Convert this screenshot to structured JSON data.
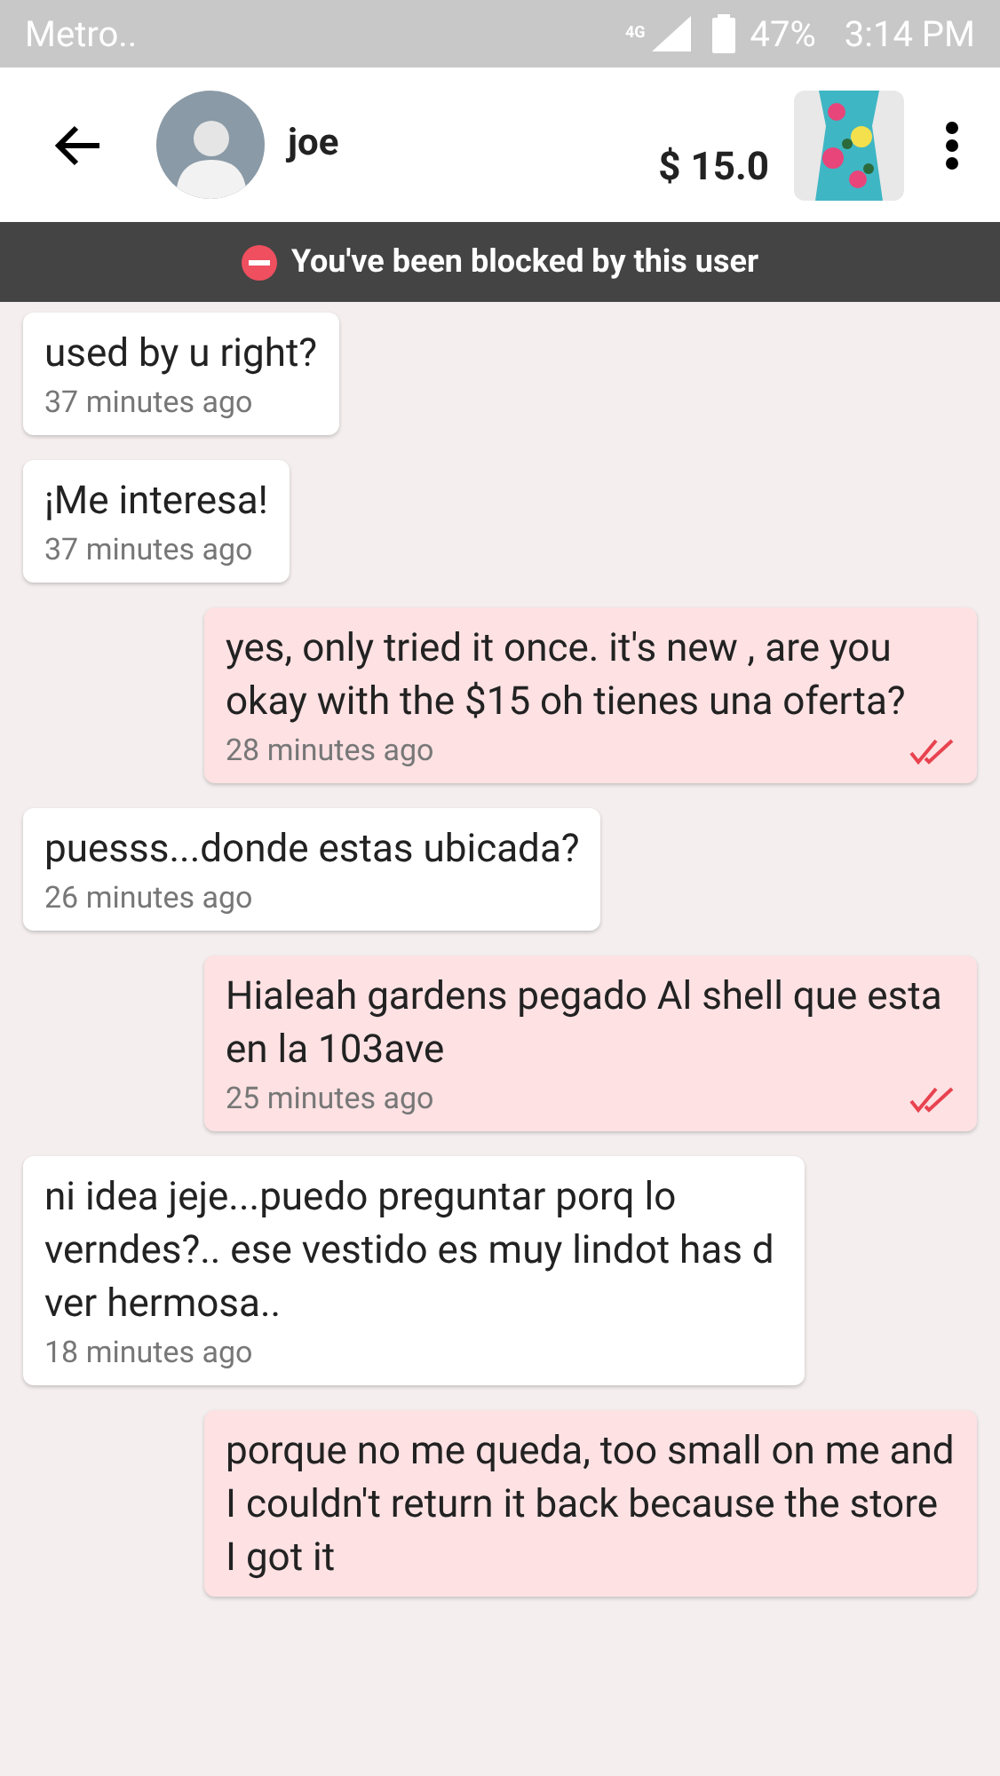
{
  "status_bar": {
    "carrier": "Metro..",
    "network": "4G",
    "battery": "47%",
    "time": "3:14 PM"
  },
  "header": {
    "user_name": "joe",
    "price": "$ 15.0"
  },
  "banner": {
    "text": "You've been blocked by this user"
  },
  "messages": [
    {
      "kind": "incoming",
      "text": "used by u right?",
      "time": "37 minutes ago"
    },
    {
      "kind": "incoming",
      "text": "¡Me interesa!",
      "time": "37 minutes ago"
    },
    {
      "kind": "outgoing",
      "text": "yes, only tried it once. it's new , are you okay with the $15 oh tienes una oferta?",
      "time": "28 minutes ago",
      "read": true
    },
    {
      "kind": "incoming",
      "text": "puesss...donde estas ubicada?",
      "time": "26 minutes ago"
    },
    {
      "kind": "outgoing",
      "text": "Hialeah gardens pegado Al shell que esta en la 103ave",
      "time": "25 minutes ago",
      "read": true
    },
    {
      "kind": "incoming",
      "text": "ni idea jeje...puedo preguntar porq lo verndes?.. ese vestido es muy lindot has d ver hermosa..",
      "time": "18 minutes ago"
    },
    {
      "kind": "outgoing",
      "text": "porque no me queda, too small on me and I couldn't return it back because the store I got it"
    }
  ]
}
